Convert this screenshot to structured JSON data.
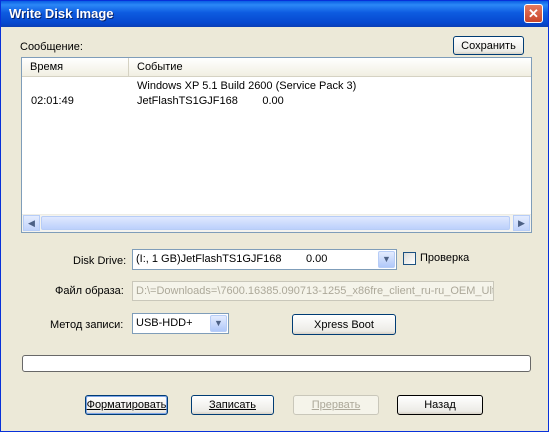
{
  "window": {
    "title": "Write Disk Image",
    "close_glyph": "✕"
  },
  "message": {
    "label": "Сообщение:",
    "save_button": "Сохранить",
    "columns": [
      "Время",
      "Событие"
    ],
    "rows": [
      {
        "time": "",
        "event": "Windows XP 5.1 Build 2600 (Service Pack 3)"
      },
      {
        "time": "02:01:49",
        "event": "JetFlashTS1GJF168        0.00"
      }
    ]
  },
  "disk_drive": {
    "label": "Disk Drive:",
    "value": "(I:, 1 GB)JetFlashTS1GJF168        0.00",
    "verify_label": "Проверка",
    "verify_checked": false
  },
  "image_file": {
    "label": "Файл образа:",
    "value": "D:\\=Downloads=\\7600.16385.090713-1255_x86fre_client_ru-ru_OEM_Ulti"
  },
  "write_method": {
    "label": "Метод записи:",
    "value": "USB-HDD+",
    "xpress_boot_button": "Xpress Boot"
  },
  "progress": {
    "value": 0
  },
  "buttons": {
    "format": "Форматировать",
    "write": "Записать",
    "abort": "Прервать",
    "back": "Назад"
  },
  "icons": {
    "dropdown": "chevron-down-icon",
    "scroll_left": "arrow-left-icon",
    "scroll_right": "arrow-right-icon",
    "close": "close-icon"
  }
}
